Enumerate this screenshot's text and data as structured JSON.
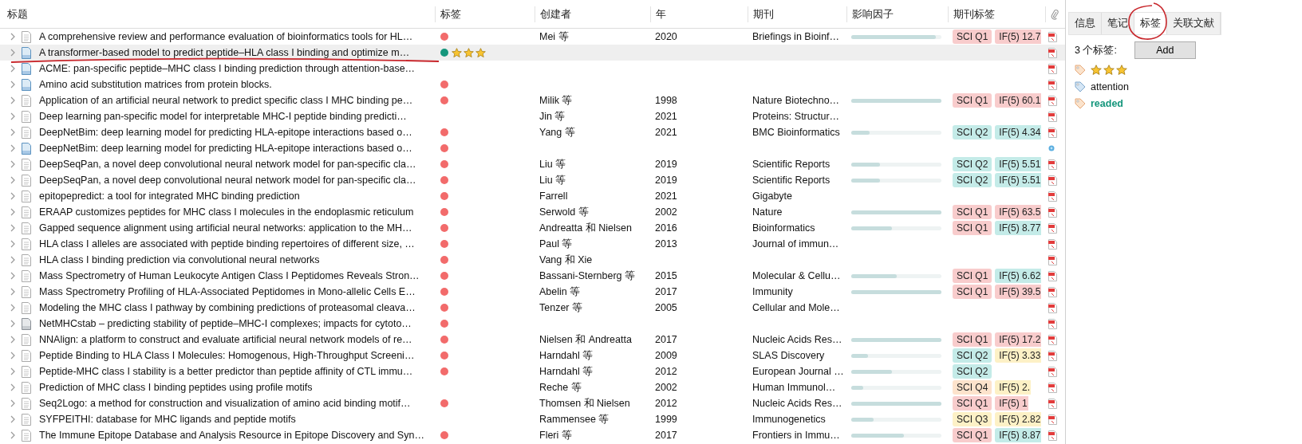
{
  "table": {
    "columns": [
      {
        "label": "标题"
      },
      {
        "label": "标签"
      },
      {
        "label": "创建者"
      },
      {
        "label": "年"
      },
      {
        "label": "期刊"
      },
      {
        "label": "影响因子"
      },
      {
        "label": "期刊标签"
      },
      {
        "kind": "attachment"
      }
    ],
    "rows": [
      {
        "title": "A comprehensive review and performance evaluation of bioinformatics tools for HL…",
        "kind": "article",
        "selected": false,
        "color": "#f26b6b",
        "creator": "Mei 等",
        "year": "2020",
        "journal": "Briefings in Bioinf…",
        "if_bar": {
          "level": 0.94
        },
        "badges": [
          {
            "label": "SCI Q1",
            "color": "#f8cccc"
          },
          {
            "label": "IF(5) 12.7",
            "color": "#f8cccc"
          }
        ],
        "attachment": {
          "kind": "pdf"
        }
      },
      {
        "title": "A transformer-based model to predict peptide–HLA class I binding and optimize m…",
        "kind": "document",
        "selected": true,
        "color": "#15967c",
        "stars": 3,
        "attachment": {
          "kind": "pdf"
        }
      },
      {
        "title": "ACME: pan-specific peptide–MHC class I binding prediction through attention-base…",
        "kind": "document",
        "selected": false,
        "attachment": {
          "kind": "pdf"
        }
      },
      {
        "title": "Amino acid substitution matrices from protein blocks.",
        "kind": "document",
        "selected": false,
        "color": "#f26b6b",
        "attachment": {
          "kind": "pdf"
        }
      },
      {
        "title": "Application of an artificial neural network to predict specific class I MHC binding pe…",
        "kind": "article",
        "selected": false,
        "color": "#f26b6b",
        "creator": "Milik 等",
        "year": "1998",
        "journal": "Nature Biotechno…",
        "if_bar": {
          "level": 1
        },
        "badges": [
          {
            "label": "SCI Q1",
            "color": "#f8cccc"
          },
          {
            "label": "IF(5) 60.1",
            "color": "#f8cccc"
          }
        ],
        "attachment": {
          "kind": "pdf"
        }
      },
      {
        "title": "Deep learning pan-specific model for interpretable MHC-I peptide binding predicti…",
        "kind": "article",
        "selected": false,
        "creator": "Jin 等",
        "year": "2021",
        "journal": "Proteins: Structur…",
        "attachment": {
          "kind": "pdf"
        }
      },
      {
        "title": "DeepNetBim: deep learning model for predicting HLA-epitope interactions based o…",
        "kind": "article",
        "selected": false,
        "color": "#f26b6b",
        "creator": "Yang 等",
        "year": "2021",
        "journal": "BMC Bioinformatics",
        "if_bar": {
          "level": 0.2
        },
        "badges": [
          {
            "label": "SCI Q2",
            "color": "#c4ebe8"
          },
          {
            "label": "IF(5) 4.34",
            "color": "#c4ebe8"
          }
        ],
        "attachment": {
          "kind": "pdf"
        }
      },
      {
        "title": "DeepNetBim: deep learning model for predicting HLA-epitope interactions based o…",
        "kind": "document",
        "selected": false,
        "color": "#f26b6b",
        "attachment": {
          "kind": "link"
        }
      },
      {
        "title": "DeepSeqPan, a novel deep convolutional neural network model for pan-specific cla…",
        "kind": "article",
        "selected": false,
        "color": "#f26b6b",
        "creator": "Liu 等",
        "year": "2019",
        "journal": "Scientific Reports",
        "if_bar": {
          "level": 0.32
        },
        "badges": [
          {
            "label": "SCI Q2",
            "color": "#c4ebe8"
          },
          {
            "label": "IF(5) 5.51",
            "color": "#c4ebe8"
          }
        ],
        "attachment": {
          "kind": "pdf"
        }
      },
      {
        "title": "DeepSeqPan, a novel deep convolutional neural network model for pan-specific cla…",
        "kind": "article",
        "selected": false,
        "color": "#f26b6b",
        "creator": "Liu 等",
        "year": "2019",
        "journal": "Scientific Reports",
        "if_bar": {
          "level": 0.32
        },
        "badges": [
          {
            "label": "SCI Q2",
            "color": "#c4ebe8"
          },
          {
            "label": "IF(5) 5.51",
            "color": "#c4ebe8"
          }
        ],
        "attachment": {
          "kind": "pdf"
        }
      },
      {
        "title": "epitopepredict: a tool for integrated MHC binding prediction",
        "kind": "article",
        "selected": false,
        "color": "#f26b6b",
        "creator": "Farrell",
        "year": "2021",
        "journal": "Gigabyte",
        "attachment": {
          "kind": "pdf"
        }
      },
      {
        "title": "ERAAP customizes peptides for MHC class I molecules in the endoplasmic reticulum",
        "kind": "article",
        "selected": false,
        "color": "#f26b6b",
        "creator": "Serwold 等",
        "year": "2002",
        "journal": "Nature",
        "if_bar": {
          "level": 1
        },
        "badges": [
          {
            "label": "SCI Q1",
            "color": "#f8cccc"
          },
          {
            "label": "IF(5) 63.5",
            "color": "#f8cccc"
          }
        ],
        "attachment": {
          "kind": "pdf"
        }
      },
      {
        "title": "Gapped sequence alignment using artificial neural networks: application to the MH…",
        "kind": "article",
        "selected": false,
        "color": "#f26b6b",
        "creator": "Andreatta 和 Nielsen",
        "year": "2016",
        "journal": "Bioinformatics",
        "if_bar": {
          "level": 0.45
        },
        "badges": [
          {
            "label": "SCI Q1",
            "color": "#f8cccc"
          },
          {
            "label": "IF(5) 8.77",
            "color": "#c4ebe8"
          }
        ],
        "attachment": {
          "kind": "pdf"
        }
      },
      {
        "title": "HLA class I alleles are associated with peptide binding repertoires of different size, …",
        "kind": "article",
        "selected": false,
        "color": "#f26b6b",
        "creator": "Paul 等",
        "year": "2013",
        "journal": "Journal of immun…",
        "attachment": {
          "kind": "pdf"
        }
      },
      {
        "title": "HLA class I binding prediction via convolutional neural networks",
        "kind": "article",
        "selected": false,
        "color": "#f26b6b",
        "creator": "Vang 和 Xie",
        "attachment": {
          "kind": "pdf"
        }
      },
      {
        "title": "Mass Spectrometry of Human Leukocyte Antigen Class I Peptidomes Reveals Stron…",
        "kind": "article",
        "selected": false,
        "color": "#f26b6b",
        "creator": "Bassani-Sternberg 等",
        "year": "2015",
        "journal": "Molecular & Cellu…",
        "if_bar": {
          "level": 0.5
        },
        "badges": [
          {
            "label": "SCI Q1",
            "color": "#f8cccc"
          },
          {
            "label": "IF(5) 6.62",
            "color": "#c4ebe8"
          }
        ],
        "attachment": {
          "kind": "pdf"
        }
      },
      {
        "title": "Mass Spectrometry Profiling of HLA-Associated Peptidomes in Mono-allelic Cells E…",
        "kind": "article",
        "selected": false,
        "color": "#f26b6b",
        "creator": "Abelin 等",
        "year": "2017",
        "journal": "Immunity",
        "if_bar": {
          "level": 1
        },
        "badges": [
          {
            "label": "SCI Q1",
            "color": "#f8cccc"
          },
          {
            "label": "IF(5) 39.5",
            "color": "#f8cccc"
          }
        ],
        "attachment": {
          "kind": "pdf"
        }
      },
      {
        "title": "Modeling the MHC class I pathway by combining predictions of proteasomal cleava…",
        "kind": "article",
        "selected": false,
        "color": "#f26b6b",
        "creator": "Tenzer 等",
        "year": "2005",
        "journal": "Cellular and Mole…",
        "attachment": {
          "kind": "pdf"
        }
      },
      {
        "title": "NetMHCstab – predicting stability of peptide–MHC-I complexes; impacts for cytoto…",
        "kind": "file",
        "selected": false,
        "color": "#f26b6b",
        "attachment": {
          "kind": "pdf"
        }
      },
      {
        "title": "NNAlign: a platform to construct and evaluate artificial neural network models of re…",
        "kind": "article",
        "selected": false,
        "color": "#f26b6b",
        "creator": "Nielsen 和 Andreatta",
        "year": "2017",
        "journal": "Nucleic Acids Res…",
        "if_bar": {
          "level": 1
        },
        "badges": [
          {
            "label": "SCI Q1",
            "color": "#f8cccc"
          },
          {
            "label": "IF(5) 17.2",
            "color": "#f8cccc"
          }
        ],
        "attachment": {
          "kind": "pdf"
        }
      },
      {
        "title": "Peptide Binding to HLA Class I Molecules: Homogenous, High-Throughput Screeni…",
        "kind": "article",
        "selected": false,
        "color": "#f26b6b",
        "creator": "Harndahl 等",
        "year": "2009",
        "journal": "SLAS Discovery",
        "if_bar": {
          "level": 0.19
        },
        "badges": [
          {
            "label": "SCI Q2",
            "color": "#c4ebe8"
          },
          {
            "label": "IF(5) 3.33",
            "color": "#fdf1c6"
          }
        ],
        "attachment": {
          "kind": "pdf"
        }
      },
      {
        "title": "Peptide-MHC class I stability is a better predictor than peptide affinity of CTL immu…",
        "kind": "article",
        "selected": false,
        "color": "#f26b6b",
        "creator": "Harndahl 等",
        "year": "2012",
        "journal": "European Journal …",
        "if_bar": {
          "level": 0.45
        },
        "badges": [
          {
            "label": "SCI Q2",
            "color": "#c4ebe8"
          }
        ],
        "attachment": {
          "kind": "pdf"
        }
      },
      {
        "title": "Prediction of MHC class I binding peptides using profile motifs",
        "kind": "article",
        "selected": false,
        "creator": "Reche 等",
        "year": "2002",
        "journal": "Human Immunol…",
        "if_bar": {
          "level": 0.13
        },
        "badges": [
          {
            "label": "SCI Q4",
            "color": "#fde3cc"
          },
          {
            "label": "IF(5) 2.",
            "color": "#fdf1c6"
          }
        ],
        "attachment": {
          "kind": "pdf"
        }
      },
      {
        "title": "Seq2Logo: a method for construction and visualization of amino acid binding motif…",
        "kind": "article",
        "selected": false,
        "color": "#f26b6b",
        "creator": "Thomsen 和 Nielsen",
        "year": "2012",
        "journal": "Nucleic Acids Res…",
        "if_bar": {
          "level": 1
        },
        "badges": [
          {
            "label": "SCI Q1",
            "color": "#f8cccc"
          },
          {
            "label": "IF(5) 1",
            "color": "#f8cccc"
          }
        ],
        "attachment": {
          "kind": "pdf"
        }
      },
      {
        "title": "SYFPEITHI: database for MHC ligands and peptide motifs",
        "kind": "article",
        "selected": false,
        "creator": "Rammensee 等",
        "year": "1999",
        "journal": "Immunogenetics",
        "if_bar": {
          "level": 0.25
        },
        "badges": [
          {
            "label": "SCI Q3",
            "color": "#fdf1c6"
          },
          {
            "label": "IF(5) 2.82",
            "color": "#fdf1c6"
          }
        ],
        "attachment": {
          "kind": "pdf"
        }
      },
      {
        "title": "The Immune Epitope Database and Analysis Resource in Epitope Discovery and Syn…",
        "kind": "article",
        "selected": false,
        "color": "#f26b6b",
        "creator": "Fleri 等",
        "year": "2017",
        "journal": "Frontiers in Immu…",
        "if_bar": {
          "level": 0.58
        },
        "badges": [
          {
            "label": "SCI Q1",
            "color": "#f8cccc"
          },
          {
            "label": "IF(5) 8.87",
            "color": "#c4ebe8"
          }
        ],
        "attachment": {
          "kind": "pdf"
        }
      }
    ]
  },
  "side_pane": {
    "tabs": [
      {
        "label": "信息",
        "selected": false
      },
      {
        "label": "笔记",
        "selected": false
      },
      {
        "label": "标签",
        "selected": true
      },
      {
        "label": "关联文献",
        "selected": false
      }
    ],
    "count_label": "3 个标签:",
    "add_button": "Add",
    "tags": [
      {
        "kind": "emoji",
        "stars": 3
      },
      {
        "kind": "plain",
        "label": "attention"
      },
      {
        "kind": "colored",
        "label": "readed",
        "color": "#15967c"
      }
    ]
  }
}
